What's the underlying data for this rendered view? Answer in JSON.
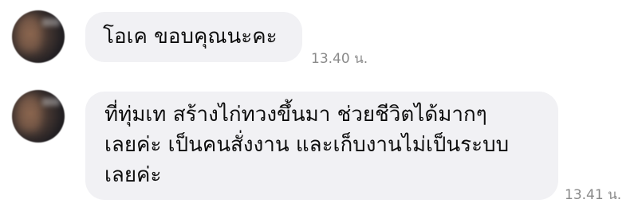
{
  "messages": [
    {
      "lines": [
        "โอเค ขอบคุณนะคะ"
      ],
      "time": "13.40 น."
    },
    {
      "lines": [
        "ที่ทุ่มเท สร้างไก่ทวงขึ้นมา ช่วยชีวิตได้มากๆ",
        "เลยค่ะ เป็นคนสั่งงาน และเก็บงานไม่เป็นระบบ",
        "เลยค่ะ"
      ],
      "time": "13.41 น."
    }
  ],
  "colors": {
    "bubble": "#f1f1f4",
    "text": "#0e0e0e",
    "timestamp": "#8a8a8a"
  }
}
